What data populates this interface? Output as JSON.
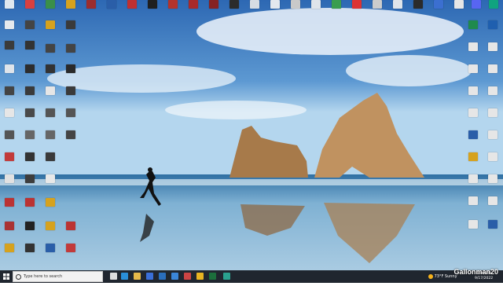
{
  "watermark": "Gallonman20",
  "taskbar": {
    "search_placeholder": "Type here to search",
    "weather": "73°F Sunny",
    "time": "1:08 PM",
    "date": "9/17/2022"
  },
  "colors": {
    "taskbar": "#20262f",
    "sky_top": "#2f6fb6",
    "sky_bottom": "#a9d3f0",
    "sea": "#4b88b6",
    "rock": "#b98a55"
  },
  "top_row": [
    "",
    "",
    "",
    "",
    "",
    "",
    "",
    "",
    "",
    "",
    "",
    "",
    "",
    "",
    "",
    "",
    "",
    "",
    "",
    "",
    "",
    "",
    "",
    "",
    "",
    "",
    "",
    "",
    "",
    ""
  ],
  "left_cols": [
    [
      "",
      "",
      "",
      "",
      "",
      "",
      "",
      "",
      "",
      "",
      "",
      "",
      ""
    ],
    [
      "",
      "",
      "",
      "",
      "",
      "",
      "",
      "",
      "",
      "",
      "",
      "",
      ""
    ],
    [
      "",
      "",
      "",
      "",
      "",
      "",
      "",
      "",
      "",
      "",
      "",
      "",
      ""
    ],
    [
      "",
      "",
      "",
      "",
      "",
      "",
      "",
      "",
      "",
      "",
      "",
      "",
      ""
    ]
  ],
  "right_cols": [
    [
      "",
      "",
      "",
      "",
      "",
      "",
      "",
      "",
      "",
      "",
      "",
      ""
    ],
    [
      "",
      "",
      "",
      "",
      "",
      "",
      "",
      "",
      "",
      "",
      "",
      ""
    ]
  ],
  "taskbar_apps": [
    "edge-icon",
    "file-explorer-icon",
    "store-icon",
    "mail-icon",
    "chrome-icon",
    "settings-icon",
    "terminal-icon",
    "app-icon",
    "photos-icon"
  ]
}
